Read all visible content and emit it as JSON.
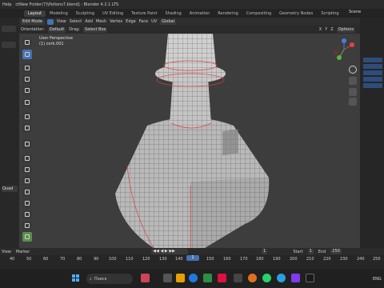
{
  "window": {
    "menu": [
      "Help"
    ],
    "title": "ctNew Folder(7)\\Potions7.blend] - Blender 4.2.1 LTS"
  },
  "tabs": [
    "Layout",
    "Modeling",
    "Sculpting",
    "UV Editing",
    "Texture Paint",
    "Shading",
    "Animation",
    "Rendering",
    "Compositing",
    "Geometry Nodes",
    "Scripting"
  ],
  "scene": "Scene",
  "header": {
    "mode": "Edit Mode",
    "menus": [
      "View",
      "Select",
      "Add",
      "Mesh",
      "Vertex",
      "Edge",
      "Face",
      "UV"
    ],
    "transform": "Global",
    "orientation_label": "Orientation:",
    "orientation_value": "Default",
    "drag_label": "Drag:",
    "drag_value": "Select Box",
    "axes": [
      "X",
      "Y",
      "Z"
    ],
    "options": "Options"
  },
  "viewport": {
    "perspective": "User Perspective",
    "object": "(1) cork.001"
  },
  "left_strip": {
    "label": "Quad"
  },
  "timeline": {
    "menus": [
      "View",
      "Marker"
    ],
    "current_frame": "1",
    "start_label": "Start",
    "start_value": "1",
    "end_label": "End",
    "end_value": "250",
    "ruler": [
      "40",
      "50",
      "60",
      "70",
      "80",
      "90",
      "100",
      "110",
      "120",
      "130",
      "140",
      "150",
      "160",
      "170",
      "180",
      "190",
      "200",
      "210",
      "220",
      "230",
      "240",
      "250"
    ],
    "playhead": "1"
  },
  "taskbar": {
    "search_placeholder": "Поиск",
    "lang": "ENG"
  }
}
